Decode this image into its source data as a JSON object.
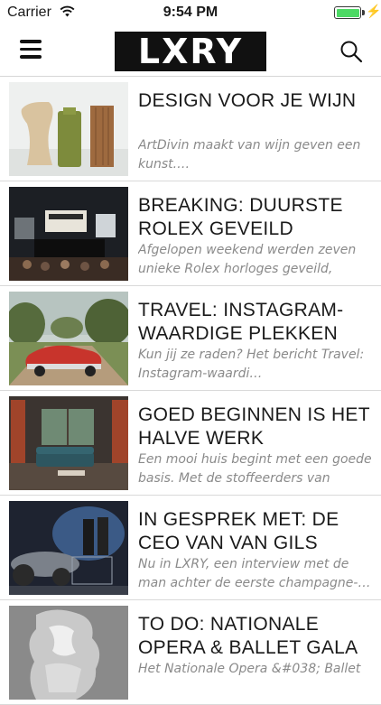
{
  "status_bar": {
    "carrier": "Carrier",
    "time": "9:54 PM",
    "battery_color": "#4cd964"
  },
  "nav": {
    "menu_icon": "hamburger-menu-icon",
    "logo": "LXRY",
    "search_icon": "search-icon"
  },
  "articles": [
    {
      "title": "DESIGN VOOR JE WIJN",
      "excerpt": "ArtDivin maakt van wijn geven een kunst.…"
    },
    {
      "title": "BREAKING: DUURSTE ROLEX GEVEILD VOOR…",
      "excerpt": "Afgelopen weekend werden zeven unieke Rolex horloges geveild, waar…"
    },
    {
      "title": "TRAVEL: INSTAGRAM-WAARDIGE PLEKKEN",
      "excerpt": "Kun jij ze raden? Het bericht Travel: Instagram-waardi…"
    },
    {
      "title": "GOED BEGINNEN IS HET HALVE WERK",
      "excerpt": "Een mooi huis begint met een goede basis. Met de stoffeerders van Zijlst…"
    },
    {
      "title": "IN GESPREK MET: DE CEO VAN VAN GILS",
      "excerpt": "Nu in LXRY, een interview met de man achter de eerste champagne-…"
    },
    {
      "title": "TO DO: NATIONALE OPERA & BALLET GALA",
      "excerpt": "Het Nationale Opera &#038; Ballet"
    }
  ]
}
